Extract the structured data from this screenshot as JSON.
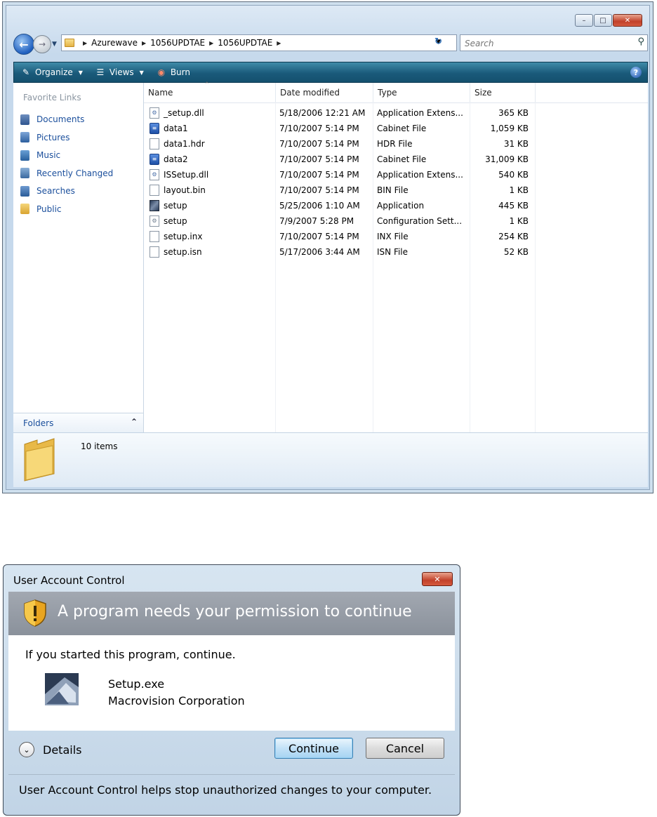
{
  "explorer": {
    "address": [
      "Azurewave",
      "1056UPDTAE",
      "1056UPDTAE"
    ],
    "search_placeholder": "Search",
    "toolbar": {
      "organize": "Organize",
      "views": "Views",
      "burn": "Burn"
    },
    "nav": {
      "favorite_title": "Favorite Links",
      "items": [
        {
          "label": "Documents",
          "icon": "documents-icon"
        },
        {
          "label": "Pictures",
          "icon": "pictures-icon"
        },
        {
          "label": "Music",
          "icon": "music-icon"
        },
        {
          "label": "Recently Changed",
          "icon": "recently-changed-icon"
        },
        {
          "label": "Searches",
          "icon": "searches-icon"
        },
        {
          "label": "Public",
          "icon": "public-folder-icon"
        }
      ],
      "folders_label": "Folders"
    },
    "columns": [
      "Name",
      "Date modified",
      "Type",
      "Size"
    ],
    "files": [
      {
        "name": "_setup.dll",
        "date": "5/18/2006 12:21 AM",
        "type": "Application Extens...",
        "size": "365 KB",
        "icon": "dll"
      },
      {
        "name": "data1",
        "date": "7/10/2007 5:14 PM",
        "type": "Cabinet File",
        "size": "1,059 KB",
        "icon": "cab"
      },
      {
        "name": "data1.hdr",
        "date": "7/10/2007 5:14 PM",
        "type": "HDR File",
        "size": "31 KB",
        "icon": "doc"
      },
      {
        "name": "data2",
        "date": "7/10/2007 5:14 PM",
        "type": "Cabinet File",
        "size": "31,009 KB",
        "icon": "cab"
      },
      {
        "name": "ISSetup.dll",
        "date": "7/10/2007 5:14 PM",
        "type": "Application Extens...",
        "size": "540 KB",
        "icon": "dll"
      },
      {
        "name": "layout.bin",
        "date": "7/10/2007 5:14 PM",
        "type": "BIN File",
        "size": "1 KB",
        "icon": "doc"
      },
      {
        "name": "setup",
        "date": "5/25/2006 1:10 AM",
        "type": "Application",
        "size": "445 KB",
        "icon": "app"
      },
      {
        "name": "setup",
        "date": "7/9/2007 5:28 PM",
        "type": "Configuration Sett...",
        "size": "1 KB",
        "icon": "cfg"
      },
      {
        "name": "setup.inx",
        "date": "7/10/2007 5:14 PM",
        "type": "INX File",
        "size": "254 KB",
        "icon": "doc"
      },
      {
        "name": "setup.isn",
        "date": "5/17/2006 3:44 AM",
        "type": "ISN File",
        "size": "52 KB",
        "icon": "doc"
      }
    ],
    "item_count": "10 items"
  },
  "uac": {
    "title": "User Account Control",
    "headline": "A program needs your permission to continue",
    "prompt": "If you started this program, continue.",
    "program_name": "Setup.exe",
    "publisher": "Macrovision Corporation",
    "details_label": "Details",
    "continue_label": "Continue",
    "cancel_label": "Cancel",
    "footer": "User Account Control helps stop unauthorized changes to your computer."
  }
}
